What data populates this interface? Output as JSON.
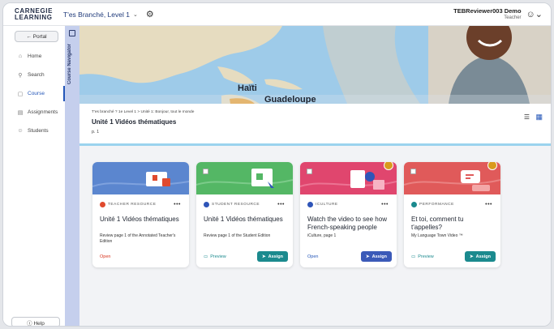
{
  "app": {
    "logo_line1": "CARNEGIE",
    "logo_line2": "LEARNING",
    "course_name": "T'es Branché, Level 1",
    "user_name": "TEBReviewer003 Demo",
    "user_role": "Teacher"
  },
  "sidebar": {
    "portal_label": "← Portal",
    "items": [
      {
        "label": "Home",
        "icon": "home-icon",
        "glyph": "⌂"
      },
      {
        "label": "Search",
        "icon": "search-icon",
        "glyph": "⚲"
      },
      {
        "label": "Course",
        "icon": "course-icon",
        "glyph": "▢"
      },
      {
        "label": "Assignments",
        "icon": "assignments-icon",
        "glyph": "▤"
      },
      {
        "label": "Students",
        "icon": "students-icon",
        "glyph": "☺"
      }
    ],
    "active_index": 2,
    "help_label": "ⓘ Help"
  },
  "navigator": {
    "label": "Course Navigator"
  },
  "hero": {
    "labels": [
      "Haïti",
      "Guadeloupe"
    ]
  },
  "header": {
    "breadcrumb": "T'es branché ? 1e Level 1   >   Unité 1: Bonjour, tout le monde",
    "title": "Unité 1 Vidéos thématiques",
    "page": "p. 1"
  },
  "cards": [
    {
      "type_label": "TEACHER RESOURCE",
      "type_color": "#e04a2e",
      "banner_color": "#5b86cf",
      "title": "Unité 1 Vidéos thématiques",
      "desc": "Review page 1 of the Annotated Teacher's Edition",
      "left_action": "Open",
      "left_color": "#d8341e",
      "has_assign": false,
      "has_checkbox": false,
      "has_badge": false
    },
    {
      "type_label": "STUDENT RESOURCE",
      "type_color": "#2f55b8",
      "banner_color": "#54b765",
      "title": "Unité 1 Vidéos thématiques",
      "desc": "Review page 1 of the Student Edition",
      "left_action": "Preview",
      "left_color": "#1b8a8e",
      "assign_label": "Assign",
      "assign_color": "#1b8a8e",
      "has_assign": true,
      "has_checkbox": true,
      "has_badge": false
    },
    {
      "type_label": "ICULTURE",
      "type_color": "#2f55b8",
      "banner_color": "#e0466e",
      "title": "Watch the video to see how French-speaking people say...",
      "desc": "iCulture, page 1",
      "left_action": "Open",
      "left_color": "#2456b8",
      "assign_label": "Assign",
      "assign_color": "#3b5ab8",
      "has_assign": true,
      "has_checkbox": true,
      "has_badge": true
    },
    {
      "type_label": "PERFORMANCE",
      "type_color": "#1b8a8e",
      "banner_color": "#e05a5a",
      "title": "Et toi, comment tu t'appelles?",
      "desc": "My Language Town Video ™",
      "left_action": "Preview",
      "left_color": "#1b8a8e",
      "assign_label": "Assign",
      "assign_color": "#1b8a8e",
      "has_assign": true,
      "has_checkbox": true,
      "has_badge": true
    }
  ]
}
